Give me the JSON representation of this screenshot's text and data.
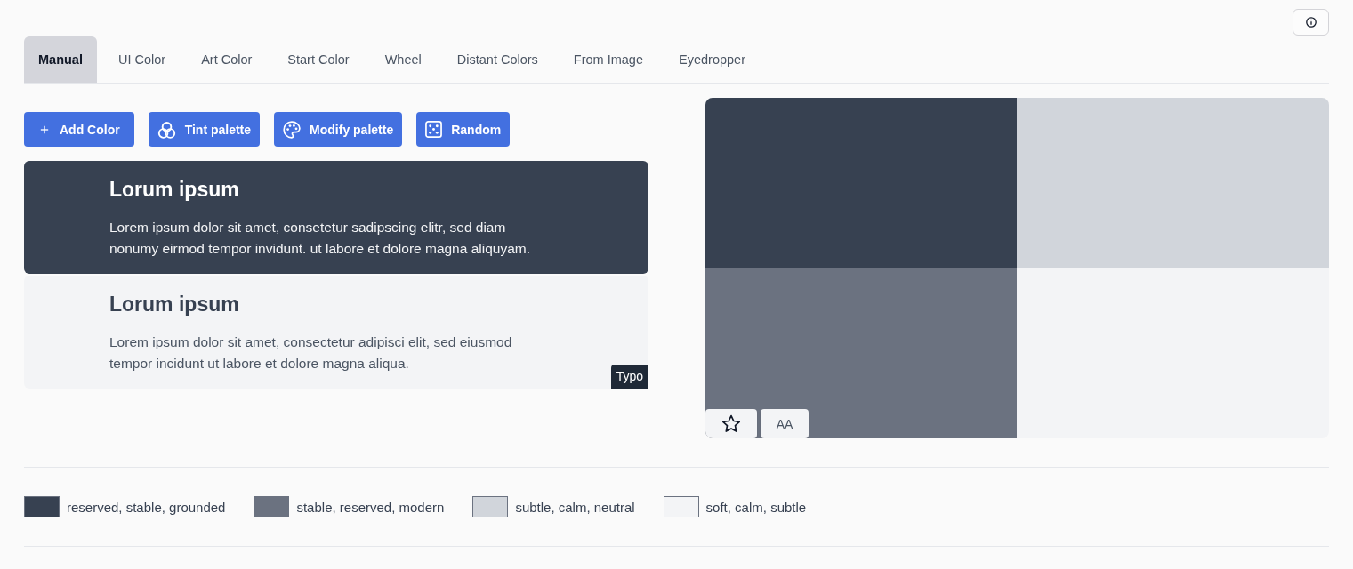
{
  "tabs": [
    {
      "label": "Manual",
      "selected": true
    },
    {
      "label": "UI Color",
      "selected": false
    },
    {
      "label": "Art Color",
      "selected": false
    },
    {
      "label": "Start Color",
      "selected": false
    },
    {
      "label": "Wheel",
      "selected": false
    },
    {
      "label": "Distant Colors",
      "selected": false
    },
    {
      "label": "From Image",
      "selected": false
    },
    {
      "label": "Eyedropper",
      "selected": false
    }
  ],
  "actions": [
    {
      "label": "Add Color"
    },
    {
      "label": "Tint palette"
    },
    {
      "label": "Modify palette"
    },
    {
      "label": "Random"
    }
  ],
  "preview": {
    "cards": [
      {
        "title": "Lorum ipsum",
        "text": "Lorem ipsum dolor sit amet, consetetur sadipscing elitr, sed diam nonumy eirmod tempor invidunt. ut labore et dolore magna aliquyam.",
        "color": "#374151"
      },
      {
        "title": "Lorum ipsum",
        "text": "Lorem ipsum dolor sit amet, consectetur adipisci elit, sed eiusmod tempor incidunt ut labore et dolore magna aliqua.",
        "color": "#f3f4f6"
      }
    ],
    "tag": "Typo"
  },
  "palette_view": {
    "tiles": [
      {
        "color": "#374151"
      },
      {
        "color": "#6b7280"
      },
      {
        "color": "#d1d5db"
      },
      {
        "color": "#f3f4f6"
      }
    ],
    "contrast_label": "AA"
  },
  "palette": [
    {
      "color": "#374151",
      "description": "reserved, stable, grounded"
    },
    {
      "color": "#6b7280",
      "description": "stable, reserved, modern"
    },
    {
      "color": "#d1d5db",
      "description": "subtle, calm, neutral"
    },
    {
      "color": "#f3f4f6",
      "description": "soft, calm, subtle"
    }
  ]
}
